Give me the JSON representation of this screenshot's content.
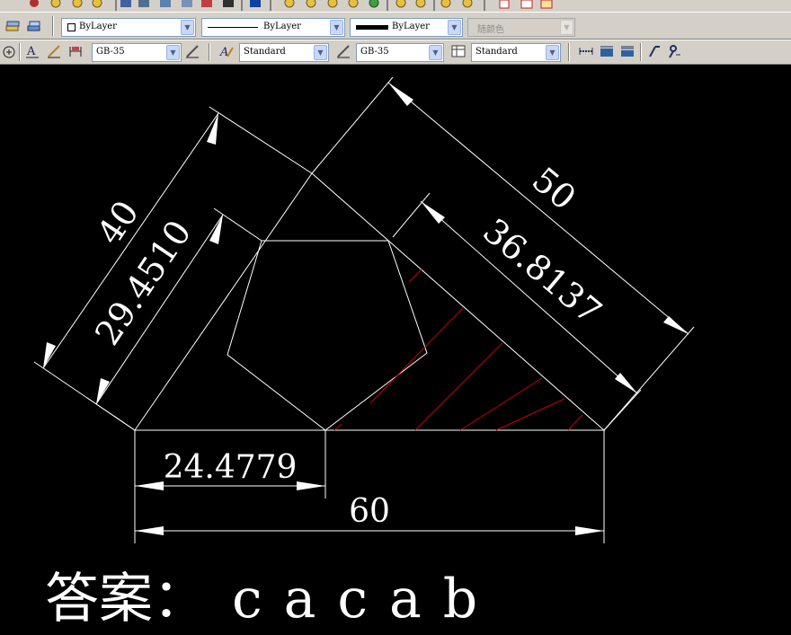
{
  "toolbar": {
    "layer_combo": {
      "value": "ByLayer"
    },
    "linetype_combo": {
      "value": "ByLayer"
    },
    "lineweight_combo": {
      "value": "ByLayer"
    },
    "plotstyle_combo": {
      "value": "随颜色"
    },
    "text_style_combo": {
      "value": "GB-35"
    },
    "dim_style_combo": {
      "value": "Standard"
    },
    "table_style_combo": {
      "value": "GB-35"
    },
    "multileader_style_combo": {
      "value": "Standard"
    }
  },
  "drawing": {
    "dim_40": "40",
    "dim_29": "29.4510",
    "dim_50": "50",
    "dim_36": "36.8137",
    "dim_24": "24.4779",
    "dim_60": "60",
    "hatch_color": "#cc0000",
    "line_color": "#ffffff",
    "background": "#000000"
  },
  "answer": {
    "label": "答案：",
    "value": "cacab"
  }
}
